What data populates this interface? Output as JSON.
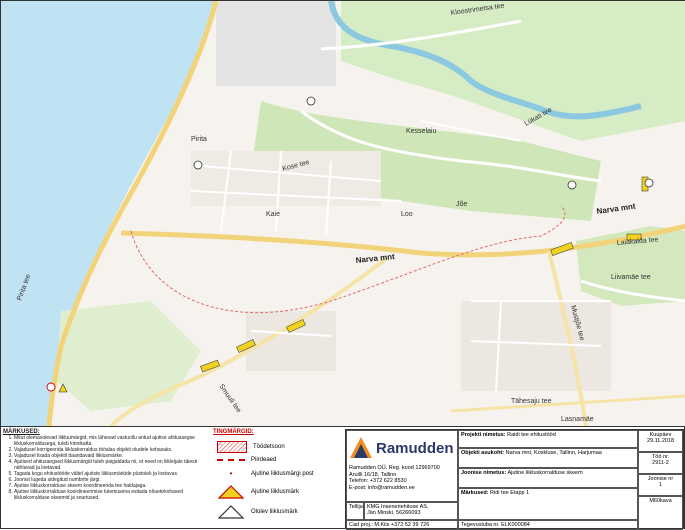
{
  "map_labels": {
    "kloostrimetsa": "Kloostrimetsa tee",
    "lukati": "Lükati tee",
    "kesselaiu": "Kesselaiu",
    "pirita_tee": "Pirita tee",
    "pirita": "Pirita",
    "kose_tee": "Kose tee",
    "narva_mnt_center": "Narva mnt",
    "narva_mnt_east": "Narva mnt",
    "laiakalda": "Laiakalda tee",
    "mustjoe": "Mustjõe tee",
    "liivamae": "Liivamäe tee",
    "smuuli": "Smuuli tee",
    "tahesaju": "Tähesaju tee",
    "lasnamae": "Lasnamäe",
    "loo": "Loo",
    "kaie": "Kaie",
    "joe": "Jõe"
  },
  "legend": {
    "notes_title": "MÄRKUSED:",
    "notes": [
      "Mitut olemasolevad liikluumärgid, mis lähevad vastuollu antud ajutise ahitusaegse liikluskorraldusega, tuleb kinnikatta.",
      "Vajadusel korrigeerida liikluskorraldus tööalas objekti oludele kohasaks.",
      "Vajadusel lisada objektil ttaandavaid liiklusmärke.",
      "Ajutised ahitusaegsed liiklusmärgid tuleb paigaldada nii, et need on liikleijale täiesti nähtavad ja loetavad.",
      "Tagada kogu ehitustööde vältel ajutiste liiklusmärkide püstolek ja loetavus.",
      "Joonist lugeda sidegitud numbrite järgi.",
      "Ajutise liikluskorralduse skeem koordineerida tee haldajaga.",
      "Ajutise liikluskorralduse koordineerimise tulemusena esitada nõuetekohased liikluskorralduse skeemid ja sourtused."
    ],
    "signs_title": "TINGMÄRGID:",
    "sign_items": [
      "Töödetsoon",
      "Piirdeaed",
      "Ajutine liiklusmärgi post",
      "Ajutine liiklusmärk",
      "Ololev liiklusmärk"
    ]
  },
  "title_block": {
    "logo_text": "Ramudden",
    "company_lines": [
      "Ramudden OÜ, Reg. kood 12969700",
      "Aruilli 16/18, Tallinn",
      "Telefon: +372 622 8530",
      "E-post: info@ramudden.ee"
    ],
    "client_label": "Tellija",
    "client_lines": [
      "KMG Inseneriehituse AS,",
      "Jän Minski, 56266093"
    ],
    "cad_proj": "Cad proj.: M.Kiis +372 52 39 726",
    "project_label": "Projekti nimetus:",
    "project_value": "Raidi tee ehitustööd",
    "object_label": "Objekti asukoht:",
    "object_value": "Narva mnt, Koskluse, Tallinn, Harjumaa",
    "drawing_label": "Joonise nimetus:",
    "drawing_value": "Ajutine liikluskorralduse skeem",
    "notes_label": "Märkused:",
    "notes_value": "Ridi tee Etapp 1",
    "order_label": "Tegevusluba nr.",
    "order_value": "ELK000084",
    "date_label": "Kuupäev",
    "date_value": "29.11.2018",
    "work_label": "Töö nr.",
    "work_value": "2911-2",
    "sheet_label": "Joonise nr",
    "sheet_value": "1",
    "scale_value": "M60kava"
  }
}
